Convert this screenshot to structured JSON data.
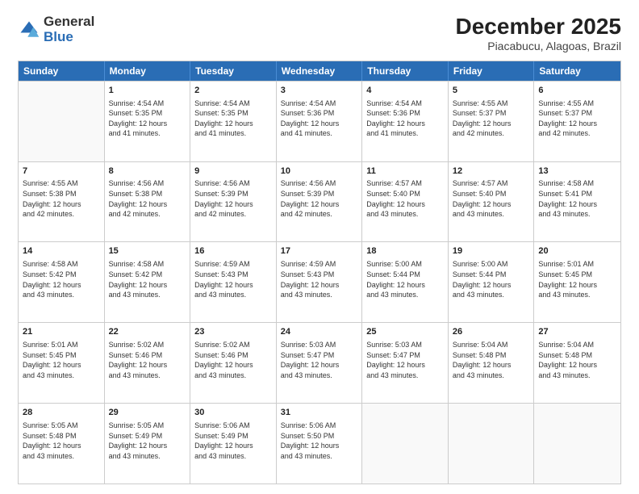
{
  "logo": {
    "general": "General",
    "blue": "Blue"
  },
  "title": {
    "month_year": "December 2025",
    "location": "Piacabucu, Alagoas, Brazil"
  },
  "calendar": {
    "headers": [
      "Sunday",
      "Monday",
      "Tuesday",
      "Wednesday",
      "Thursday",
      "Friday",
      "Saturday"
    ],
    "weeks": [
      [
        {
          "day": "",
          "info": ""
        },
        {
          "day": "1",
          "info": "Sunrise: 4:54 AM\nSunset: 5:35 PM\nDaylight: 12 hours\nand 41 minutes."
        },
        {
          "day": "2",
          "info": "Sunrise: 4:54 AM\nSunset: 5:35 PM\nDaylight: 12 hours\nand 41 minutes."
        },
        {
          "day": "3",
          "info": "Sunrise: 4:54 AM\nSunset: 5:36 PM\nDaylight: 12 hours\nand 41 minutes."
        },
        {
          "day": "4",
          "info": "Sunrise: 4:54 AM\nSunset: 5:36 PM\nDaylight: 12 hours\nand 41 minutes."
        },
        {
          "day": "5",
          "info": "Sunrise: 4:55 AM\nSunset: 5:37 PM\nDaylight: 12 hours\nand 42 minutes."
        },
        {
          "day": "6",
          "info": "Sunrise: 4:55 AM\nSunset: 5:37 PM\nDaylight: 12 hours\nand 42 minutes."
        }
      ],
      [
        {
          "day": "7",
          "info": "Sunrise: 4:55 AM\nSunset: 5:38 PM\nDaylight: 12 hours\nand 42 minutes."
        },
        {
          "day": "8",
          "info": "Sunrise: 4:56 AM\nSunset: 5:38 PM\nDaylight: 12 hours\nand 42 minutes."
        },
        {
          "day": "9",
          "info": "Sunrise: 4:56 AM\nSunset: 5:39 PM\nDaylight: 12 hours\nand 42 minutes."
        },
        {
          "day": "10",
          "info": "Sunrise: 4:56 AM\nSunset: 5:39 PM\nDaylight: 12 hours\nand 42 minutes."
        },
        {
          "day": "11",
          "info": "Sunrise: 4:57 AM\nSunset: 5:40 PM\nDaylight: 12 hours\nand 43 minutes."
        },
        {
          "day": "12",
          "info": "Sunrise: 4:57 AM\nSunset: 5:40 PM\nDaylight: 12 hours\nand 43 minutes."
        },
        {
          "day": "13",
          "info": "Sunrise: 4:58 AM\nSunset: 5:41 PM\nDaylight: 12 hours\nand 43 minutes."
        }
      ],
      [
        {
          "day": "14",
          "info": "Sunrise: 4:58 AM\nSunset: 5:42 PM\nDaylight: 12 hours\nand 43 minutes."
        },
        {
          "day": "15",
          "info": "Sunrise: 4:58 AM\nSunset: 5:42 PM\nDaylight: 12 hours\nand 43 minutes."
        },
        {
          "day": "16",
          "info": "Sunrise: 4:59 AM\nSunset: 5:43 PM\nDaylight: 12 hours\nand 43 minutes."
        },
        {
          "day": "17",
          "info": "Sunrise: 4:59 AM\nSunset: 5:43 PM\nDaylight: 12 hours\nand 43 minutes."
        },
        {
          "day": "18",
          "info": "Sunrise: 5:00 AM\nSunset: 5:44 PM\nDaylight: 12 hours\nand 43 minutes."
        },
        {
          "day": "19",
          "info": "Sunrise: 5:00 AM\nSunset: 5:44 PM\nDaylight: 12 hours\nand 43 minutes."
        },
        {
          "day": "20",
          "info": "Sunrise: 5:01 AM\nSunset: 5:45 PM\nDaylight: 12 hours\nand 43 minutes."
        }
      ],
      [
        {
          "day": "21",
          "info": "Sunrise: 5:01 AM\nSunset: 5:45 PM\nDaylight: 12 hours\nand 43 minutes."
        },
        {
          "day": "22",
          "info": "Sunrise: 5:02 AM\nSunset: 5:46 PM\nDaylight: 12 hours\nand 43 minutes."
        },
        {
          "day": "23",
          "info": "Sunrise: 5:02 AM\nSunset: 5:46 PM\nDaylight: 12 hours\nand 43 minutes."
        },
        {
          "day": "24",
          "info": "Sunrise: 5:03 AM\nSunset: 5:47 PM\nDaylight: 12 hours\nand 43 minutes."
        },
        {
          "day": "25",
          "info": "Sunrise: 5:03 AM\nSunset: 5:47 PM\nDaylight: 12 hours\nand 43 minutes."
        },
        {
          "day": "26",
          "info": "Sunrise: 5:04 AM\nSunset: 5:48 PM\nDaylight: 12 hours\nand 43 minutes."
        },
        {
          "day": "27",
          "info": "Sunrise: 5:04 AM\nSunset: 5:48 PM\nDaylight: 12 hours\nand 43 minutes."
        }
      ],
      [
        {
          "day": "28",
          "info": "Sunrise: 5:05 AM\nSunset: 5:48 PM\nDaylight: 12 hours\nand 43 minutes."
        },
        {
          "day": "29",
          "info": "Sunrise: 5:05 AM\nSunset: 5:49 PM\nDaylight: 12 hours\nand 43 minutes."
        },
        {
          "day": "30",
          "info": "Sunrise: 5:06 AM\nSunset: 5:49 PM\nDaylight: 12 hours\nand 43 minutes."
        },
        {
          "day": "31",
          "info": "Sunrise: 5:06 AM\nSunset: 5:50 PM\nDaylight: 12 hours\nand 43 minutes."
        },
        {
          "day": "",
          "info": ""
        },
        {
          "day": "",
          "info": ""
        },
        {
          "day": "",
          "info": ""
        }
      ]
    ]
  }
}
